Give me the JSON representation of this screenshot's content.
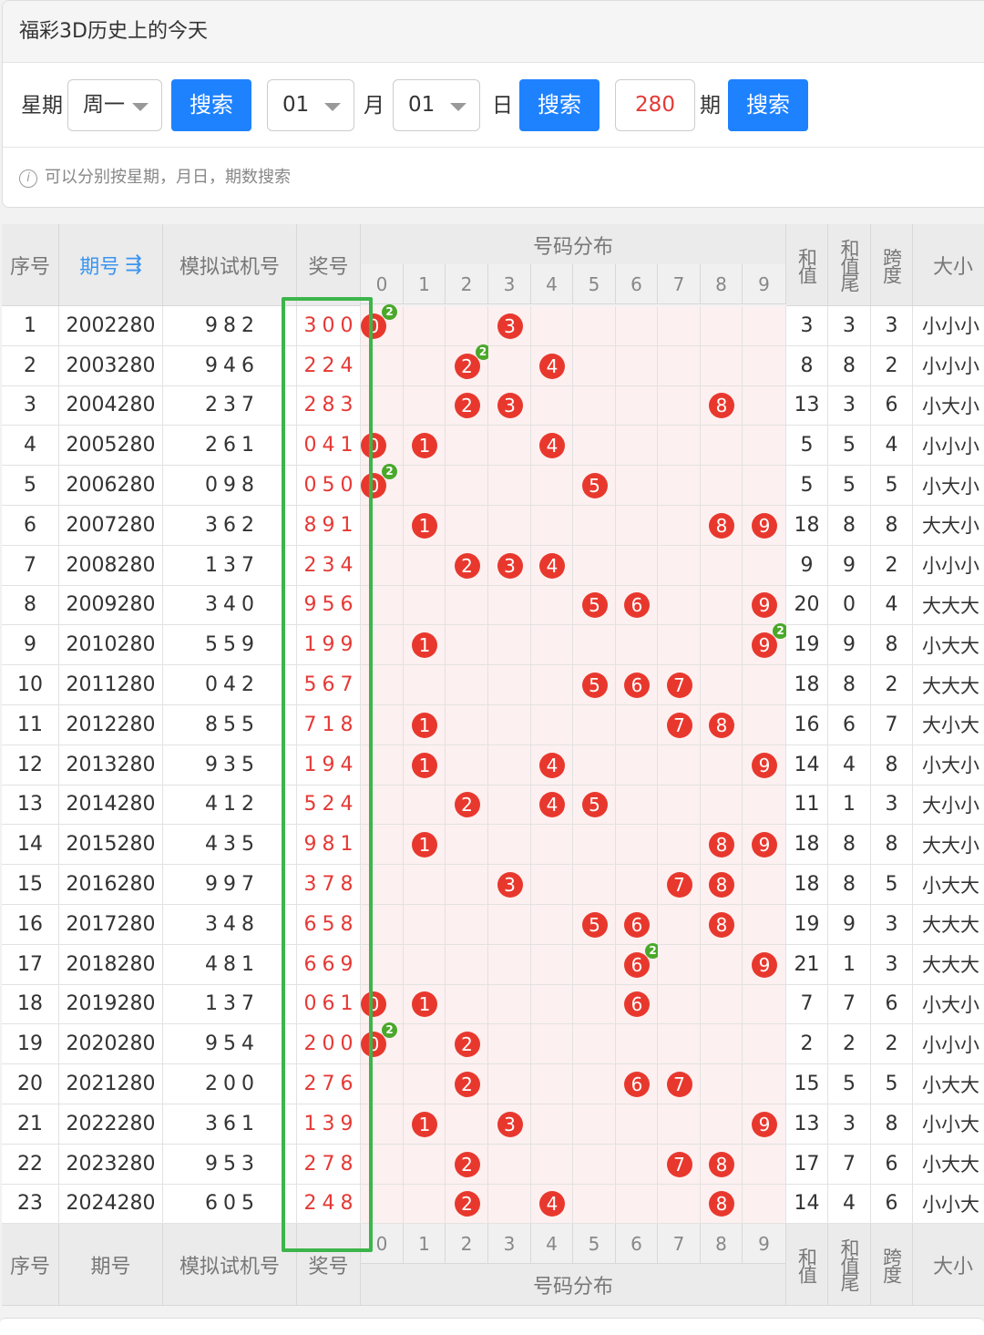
{
  "card_title": "福彩3D历史上的今天",
  "search": {
    "weekday_label": "星期",
    "weekday_value": "周一",
    "search_label": "搜索",
    "month_value": "01",
    "month_label": "月",
    "day_value": "01",
    "day_label": "日",
    "period_value": "280",
    "period_label": "期",
    "tip_icon": "i",
    "tip": "可以分别按星期，月日，期数搜索"
  },
  "table": {
    "headers": {
      "index": "序号",
      "period": "期号",
      "sort_icon": "⇶",
      "machine": "模拟试机号",
      "prize": "奖号",
      "dist": "号码分布",
      "sum": "和值",
      "sum_tail": "和值尾",
      "span": "跨度",
      "size": "大小"
    },
    "digits": [
      "0",
      "1",
      "2",
      "3",
      "4",
      "5",
      "6",
      "7",
      "8",
      "9"
    ],
    "rows": [
      {
        "idx": "1",
        "period": "2002280",
        "machine": "982",
        "prize": "300",
        "sum": "3",
        "tail": "3",
        "span": "3",
        "size": "小小小"
      },
      {
        "idx": "2",
        "period": "2003280",
        "machine": "946",
        "prize": "224",
        "sum": "8",
        "tail": "8",
        "span": "2",
        "size": "小小小"
      },
      {
        "idx": "3",
        "period": "2004280",
        "machine": "237",
        "prize": "283",
        "sum": "13",
        "tail": "3",
        "span": "6",
        "size": "小大小"
      },
      {
        "idx": "4",
        "period": "2005280",
        "machine": "261",
        "prize": "041",
        "sum": "5",
        "tail": "5",
        "span": "4",
        "size": "小小小"
      },
      {
        "idx": "5",
        "period": "2006280",
        "machine": "098",
        "prize": "050",
        "sum": "5",
        "tail": "5",
        "span": "5",
        "size": "小大小"
      },
      {
        "idx": "6",
        "period": "2007280",
        "machine": "362",
        "prize": "891",
        "sum": "18",
        "tail": "8",
        "span": "8",
        "size": "大大小"
      },
      {
        "idx": "7",
        "period": "2008280",
        "machine": "137",
        "prize": "234",
        "sum": "9",
        "tail": "9",
        "span": "2",
        "size": "小小小"
      },
      {
        "idx": "8",
        "period": "2009280",
        "machine": "340",
        "prize": "956",
        "sum": "20",
        "tail": "0",
        "span": "4",
        "size": "大大大"
      },
      {
        "idx": "9",
        "period": "2010280",
        "machine": "559",
        "prize": "199",
        "sum": "19",
        "tail": "9",
        "span": "8",
        "size": "小大大"
      },
      {
        "idx": "10",
        "period": "2011280",
        "machine": "042",
        "prize": "567",
        "sum": "18",
        "tail": "8",
        "span": "2",
        "size": "大大大"
      },
      {
        "idx": "11",
        "period": "2012280",
        "machine": "855",
        "prize": "718",
        "sum": "16",
        "tail": "6",
        "span": "7",
        "size": "大小大"
      },
      {
        "idx": "12",
        "period": "2013280",
        "machine": "935",
        "prize": "194",
        "sum": "14",
        "tail": "4",
        "span": "8",
        "size": "小大小"
      },
      {
        "idx": "13",
        "period": "2014280",
        "machine": "412",
        "prize": "524",
        "sum": "11",
        "tail": "1",
        "span": "3",
        "size": "大小小"
      },
      {
        "idx": "14",
        "period": "2015280",
        "machine": "435",
        "prize": "981",
        "sum": "18",
        "tail": "8",
        "span": "8",
        "size": "大大小"
      },
      {
        "idx": "15",
        "period": "2016280",
        "machine": "997",
        "prize": "378",
        "sum": "18",
        "tail": "8",
        "span": "5",
        "size": "小大大"
      },
      {
        "idx": "16",
        "period": "2017280",
        "machine": "348",
        "prize": "658",
        "sum": "19",
        "tail": "9",
        "span": "3",
        "size": "大大大"
      },
      {
        "idx": "17",
        "period": "2018280",
        "machine": "481",
        "prize": "669",
        "sum": "21",
        "tail": "1",
        "span": "3",
        "size": "大大大"
      },
      {
        "idx": "18",
        "period": "2019280",
        "machine": "137",
        "prize": "061",
        "sum": "7",
        "tail": "7",
        "span": "6",
        "size": "小大小"
      },
      {
        "idx": "19",
        "period": "2020280",
        "machine": "954",
        "prize": "200",
        "sum": "2",
        "tail": "2",
        "span": "2",
        "size": "小小小"
      },
      {
        "idx": "20",
        "period": "2021280",
        "machine": "200",
        "prize": "276",
        "sum": "15",
        "tail": "5",
        "span": "5",
        "size": "小大大"
      },
      {
        "idx": "21",
        "period": "2022280",
        "machine": "361",
        "prize": "139",
        "sum": "13",
        "tail": "3",
        "span": "8",
        "size": "小小大"
      },
      {
        "idx": "22",
        "period": "2023280",
        "machine": "953",
        "prize": "278",
        "sum": "17",
        "tail": "7",
        "span": "6",
        "size": "小大大"
      },
      {
        "idx": "23",
        "period": "2024280",
        "machine": "605",
        "prize": "248",
        "sum": "14",
        "tail": "4",
        "span": "6",
        "size": "小小大"
      }
    ]
  },
  "colors": {
    "accent": "#1e82ff",
    "ball": "#e8382e",
    "repeat_badge": "#4aa82a",
    "highlight_box": "#3cb54a",
    "prize_text": "#e53935"
  }
}
